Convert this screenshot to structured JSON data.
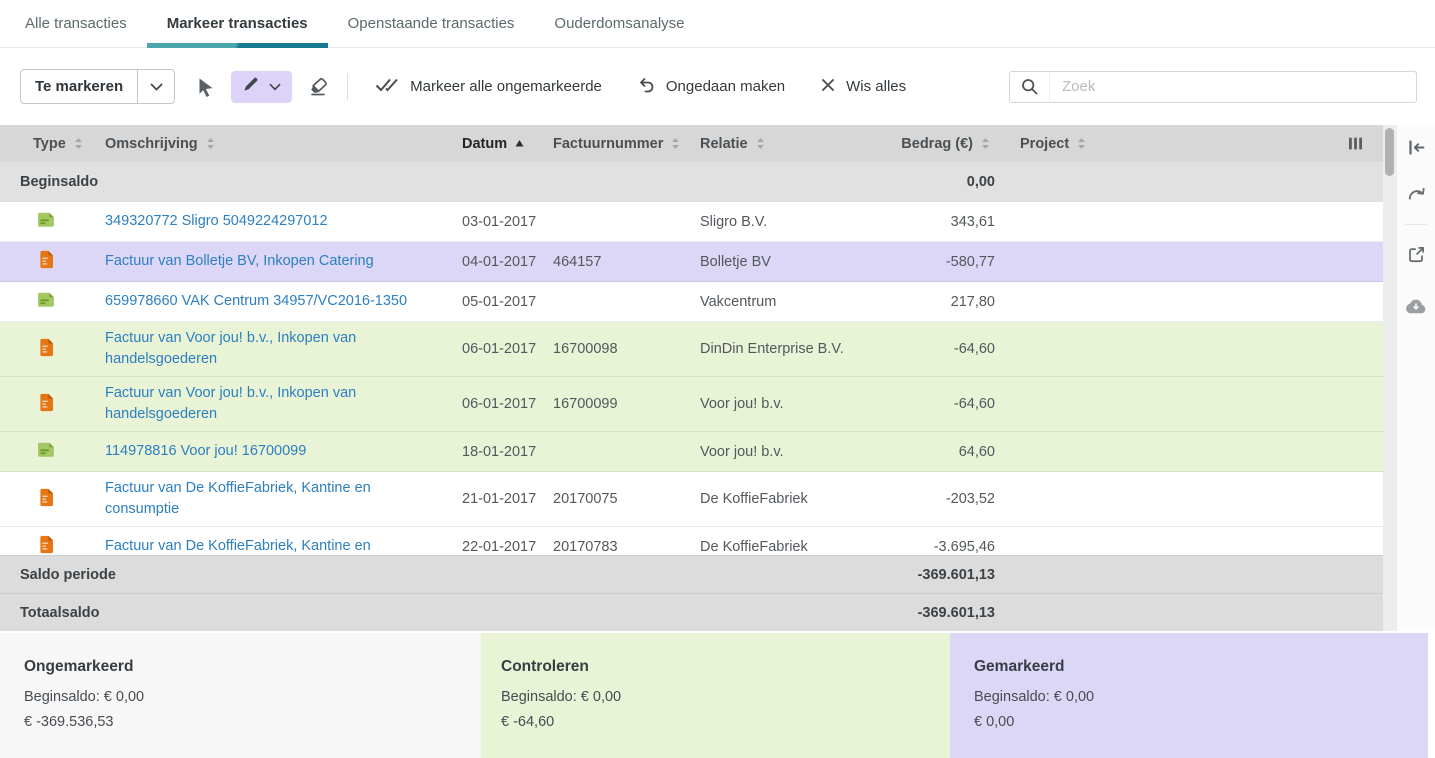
{
  "tabs": [
    {
      "label": "Alle transacties",
      "active": false
    },
    {
      "label": "Markeer transacties",
      "active": true
    },
    {
      "label": "Openstaande transacties",
      "active": false
    },
    {
      "label": "Ouderdomsanalyse",
      "active": false
    }
  ],
  "toolbar": {
    "mode_button": "Te markeren",
    "mark_all": "Markeer alle ongemarkeerde",
    "undo": "Ongedaan maken",
    "clear_all": "Wis alles",
    "search_placeholder": "Zoek"
  },
  "table": {
    "columns": [
      {
        "label": "Type",
        "sorted": null
      },
      {
        "label": "Omschrijving",
        "sorted": null
      },
      {
        "label": "Datum",
        "sorted": "asc"
      },
      {
        "label": "Factuurnummer",
        "sorted": null
      },
      {
        "label": "Relatie",
        "sorted": null
      },
      {
        "label": "Bedrag (€)",
        "sorted": null,
        "align": "right"
      },
      {
        "label": "Project",
        "sorted": null
      }
    ],
    "begin_row": {
      "label": "Beginsaldo",
      "value": "0,00"
    },
    "rows": [
      {
        "type": "bank",
        "description": "349320772 Sligro 5049224297012",
        "date": "03-01-2017",
        "invoice_number": "",
        "relation": "Sligro B.V.",
        "amount": "343,61",
        "project": "",
        "highlight": "none"
      },
      {
        "type": "invoice",
        "description": "Factuur van Bolletje BV, Inkopen Catering",
        "date": "04-01-2017",
        "invoice_number": "464157",
        "relation": "Bolletje BV",
        "amount": "-580,77",
        "project": "",
        "highlight": "marked"
      },
      {
        "type": "bank",
        "description": "659978660 VAK Centrum 34957/VC2016-1350",
        "date": "05-01-2017",
        "invoice_number": "",
        "relation": "Vakcentrum",
        "amount": "217,80",
        "project": "",
        "highlight": "none"
      },
      {
        "type": "invoice",
        "description": "Factuur van Voor jou! b.v., Inkopen van handelsgoederen",
        "date": "06-01-2017",
        "invoice_number": "16700098",
        "relation": "DinDin Enterprise B.V.",
        "amount": "-64,60",
        "project": "",
        "highlight": "check"
      },
      {
        "type": "invoice",
        "description": "Factuur van Voor jou! b.v., Inkopen van handelsgoederen",
        "date": "06-01-2017",
        "invoice_number": "16700099",
        "relation": "Voor jou! b.v.",
        "amount": "-64,60",
        "project": "",
        "highlight": "check"
      },
      {
        "type": "bank",
        "description": "114978816 Voor jou! 16700099",
        "date": "18-01-2017",
        "invoice_number": "",
        "relation": "Voor jou! b.v.",
        "amount": "64,60",
        "project": "",
        "highlight": "check"
      },
      {
        "type": "invoice",
        "description": "Factuur van De KoffieFabriek, Kantine en consumptie",
        "date": "21-01-2017",
        "invoice_number": "20170075",
        "relation": "De KoffieFabriek",
        "amount": "-203,52",
        "project": "",
        "highlight": "none"
      },
      {
        "type": "invoice",
        "description": "Factuur van De KoffieFabriek, Kantine en",
        "date": "22-01-2017",
        "invoice_number": "20170783",
        "relation": "De KoffieFabriek",
        "amount": "-3.695,46",
        "project": "",
        "highlight": "none"
      }
    ],
    "summary_rows": [
      {
        "label": "Saldo periode",
        "value": "-369.601,13"
      },
      {
        "label": "Totaalsaldo",
        "value": "-369.601,13"
      }
    ]
  },
  "footer_cards": [
    {
      "title": "Ongemarkeerd",
      "beginsaldo": "Beginsaldo: € 0,00",
      "amount": "€ -369.536,53",
      "kind": "unmarked"
    },
    {
      "title": "Controleren",
      "beginsaldo": "Beginsaldo: € 0,00",
      "amount": "€ -64,60",
      "kind": "check"
    },
    {
      "title": "Gemarkeerd",
      "beginsaldo": "Beginsaldo: € 0,00",
      "amount": "€ 0,00",
      "kind": "marked"
    }
  ],
  "icons": {
    "toolbar": [
      "chevron-down",
      "select-cursor",
      "marker-pencil",
      "eraser",
      "double-check",
      "undo-arrow",
      "close-x",
      "magnifier"
    ],
    "table": [
      "sort-both",
      "sort-asc",
      "column-settings",
      "bank-document",
      "invoice-document"
    ],
    "side_panel": [
      "collapse-left",
      "redo-arrow",
      "open-external",
      "cloud-download"
    ]
  },
  "colors": {
    "accent_teal_light": "#4aa5ad",
    "accent_teal_dark": "#167a8f",
    "marked_purple": "#ddd7f7",
    "check_green": "#e9f3d6",
    "link_blue": "#2c7fc0"
  }
}
